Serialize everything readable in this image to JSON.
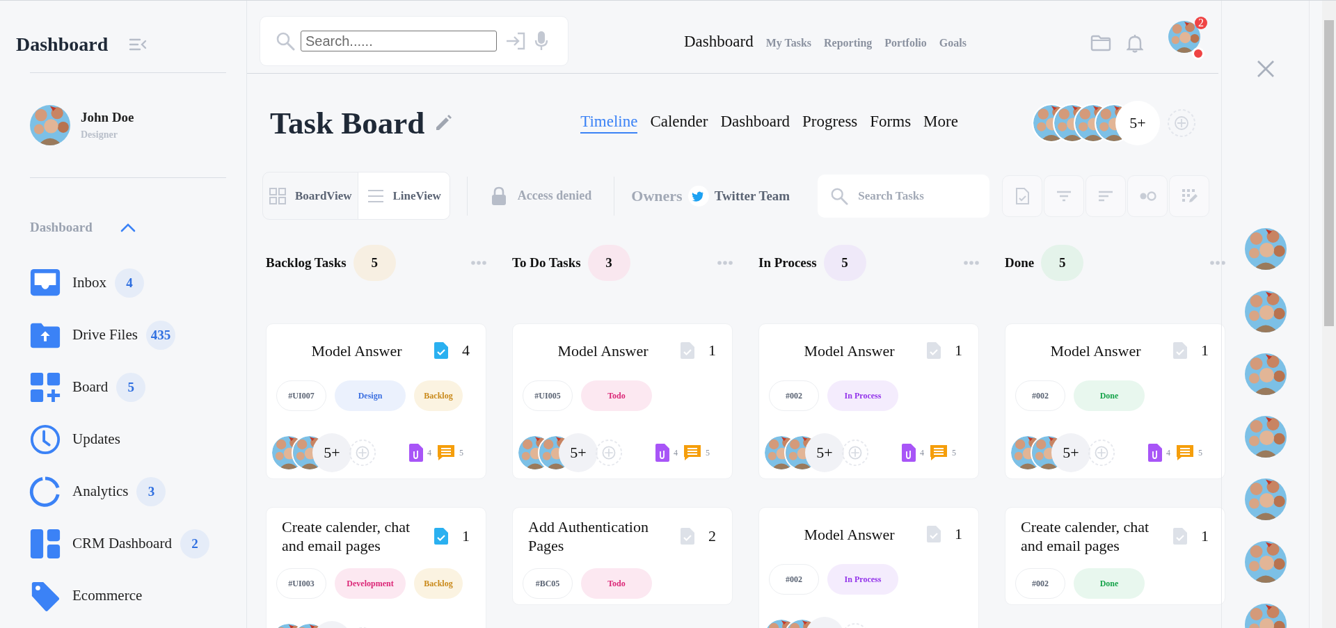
{
  "sidebar": {
    "title": "Dashboard",
    "profile": {
      "name": "John Doe",
      "role": "Designer"
    },
    "section": {
      "label": "Dashboard",
      "expanded": true
    },
    "items": [
      {
        "label": "Inbox",
        "badge": "4"
      },
      {
        "label": "Drive Files",
        "badge": "435"
      },
      {
        "label": "Board",
        "badge": "5"
      },
      {
        "label": "Updates"
      },
      {
        "label": "Analytics",
        "badge": "3"
      },
      {
        "label": "CRM Dashboard",
        "badge": "2"
      },
      {
        "label": "Ecommerce"
      }
    ]
  },
  "topbar": {
    "search": {
      "placeholder": "Search......"
    },
    "nav": [
      {
        "label": "Dashboard",
        "selected": true
      },
      {
        "label": "My Tasks",
        "selected": false
      },
      {
        "label": "Reporting",
        "selected": false
      },
      {
        "label": "Portfolio",
        "selected": false
      },
      {
        "label": "Goals",
        "selected": false
      }
    ],
    "notifications": "2",
    "online": true
  },
  "board": {
    "title": "Task Board",
    "tabs": [
      {
        "label": "Timeline",
        "selected": true
      },
      {
        "label": "Calender",
        "selected": false
      },
      {
        "label": "Dashboard",
        "selected": false
      },
      {
        "label": "Progress",
        "selected": false
      },
      {
        "label": "Forms",
        "selected": false
      },
      {
        "label": "More",
        "selected": false
      }
    ],
    "members_more": "5+"
  },
  "toolbar": {
    "views": [
      {
        "label": "BoardView",
        "selected": false
      },
      {
        "label": "LineView",
        "selected": true
      }
    ],
    "access": "Access denied",
    "owners": "Owners",
    "team": "Twitter Team",
    "search": {
      "placeholder": "Search Tasks"
    }
  },
  "columns": [
    {
      "title": "Backlog Tasks",
      "count": "5",
      "color": "#f7efe2",
      "cards": [
        {
          "title": "Model Answer",
          "doc_highlighted": true,
          "files": "4",
          "id": "#UI007",
          "tags": [
            {
              "label": "Design",
              "kind": "design"
            },
            {
              "label": "Backlog",
              "kind": "backlog"
            }
          ],
          "footer": {
            "more": "5+",
            "attachments": "4",
            "comments": "5"
          }
        },
        {
          "title": "Create calender, chat and email pages",
          "doc_highlighted": true,
          "files": "1",
          "id": "#UI003",
          "tags": [
            {
              "label": "Development",
              "kind": "development"
            },
            {
              "label": "Backlog",
              "kind": "backlog"
            }
          ],
          "footer_cut": true
        }
      ]
    },
    {
      "title": "To Do Tasks",
      "count": "3",
      "color": "#f9e7ef",
      "cards": [
        {
          "title": "Model Answer",
          "doc_highlighted": false,
          "files": "1",
          "id": "#UI005",
          "tags": [
            {
              "label": "Todo",
              "kind": "todo"
            }
          ],
          "footer": {
            "more": "5+",
            "attachments": "4",
            "comments": "5"
          }
        },
        {
          "title": "Add Authentication Pages",
          "doc_highlighted": false,
          "files": "2",
          "id": "#BC05",
          "tags": [
            {
              "label": "Todo",
              "kind": "todo"
            }
          ]
        }
      ]
    },
    {
      "title": "In Process",
      "count": "5",
      "color": "#efe9f9",
      "cards": [
        {
          "title": "Model Answer",
          "doc_highlighted": false,
          "files": "1",
          "id": "#002",
          "tags": [
            {
              "label": "In Process",
              "kind": "process"
            }
          ],
          "footer": {
            "more": "5+",
            "attachments": "4",
            "comments": "5"
          }
        },
        {
          "title": "Model Answer",
          "doc_highlighted": false,
          "files": "1",
          "id": "#002",
          "tags": [
            {
              "label": "In Process",
              "kind": "process"
            }
          ],
          "footer_cut": true
        }
      ]
    },
    {
      "title": "Done",
      "count": "5",
      "color": "#e4f3ea",
      "cards": [
        {
          "title": "Model Answer",
          "doc_highlighted": false,
          "files": "1",
          "id": "#002",
          "tags": [
            {
              "label": "Done",
              "kind": "done"
            }
          ],
          "footer": {
            "more": "5+",
            "attachments": "4",
            "comments": "5"
          }
        },
        {
          "title": "Create calender, chat and email pages",
          "doc_highlighted": false,
          "files": "1",
          "id": "#002",
          "tags": [
            {
              "label": "Done",
              "kind": "done"
            }
          ]
        }
      ]
    }
  ]
}
